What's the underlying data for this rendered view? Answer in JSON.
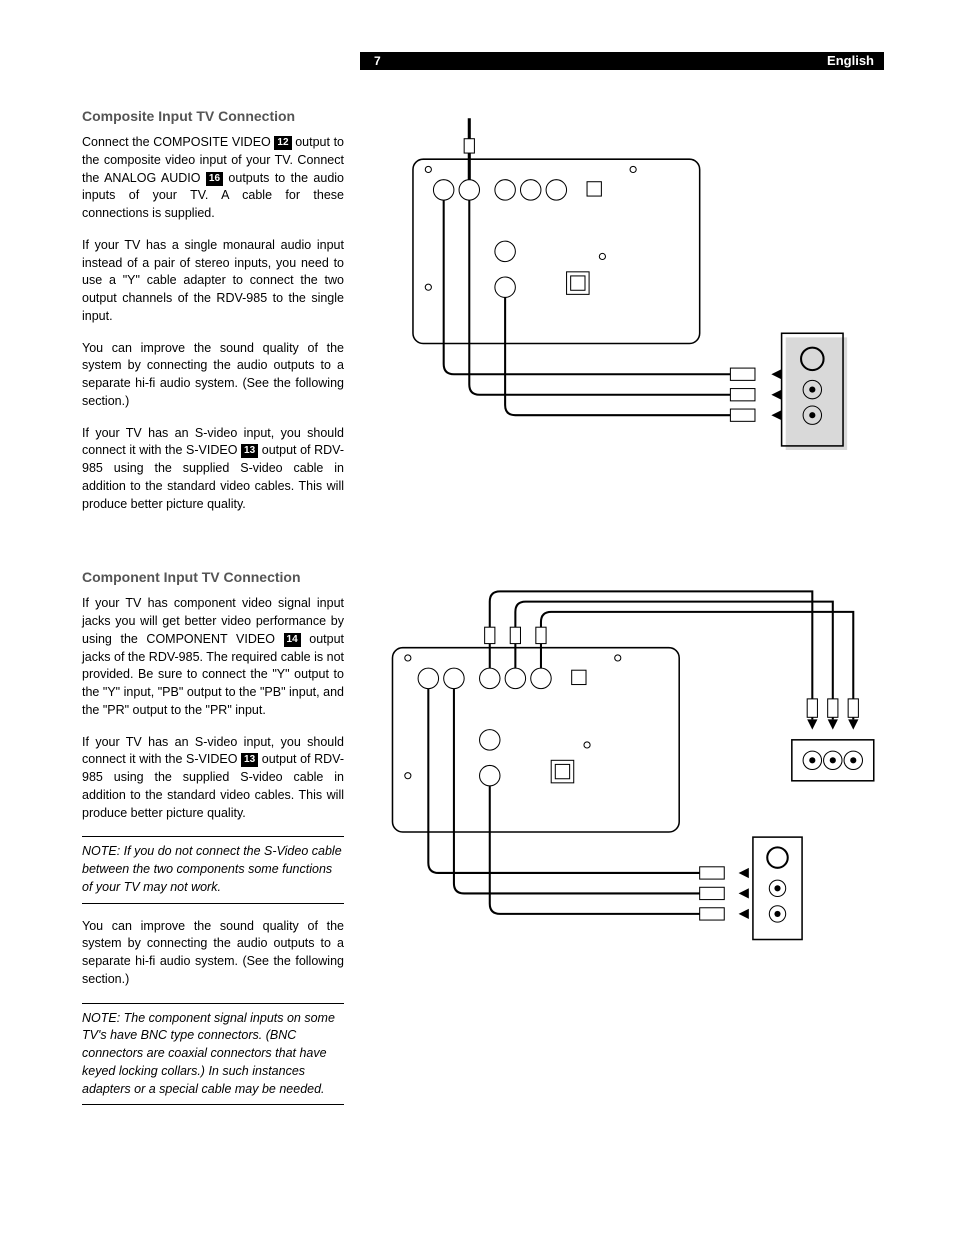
{
  "header": {
    "page_number": "7",
    "language": "English"
  },
  "refs": {
    "r12": "12",
    "r13": "13",
    "r14": "14",
    "r16": "16"
  },
  "section1": {
    "title": "Composite Input TV Connection",
    "p1a": "Connect the COMPOSITE VIDEO ",
    "p1b": " output to the composite video input of your TV. Connect the ANALOG AUDIO ",
    "p1c": " outputs to the audio inputs of your TV. A cable for these connections is supplied.",
    "p2": "If your TV has a single monaural audio input instead of a pair of stereo inputs, you need to use a \"Y\" cable adapter to connect the two output channels of the RDV-985 to the single input.",
    "p3": "You can improve the sound quality of the system by connecting the audio outputs to a separate hi-fi audio system. (See the following section.)",
    "p4a": "If your TV has an S-video input, you should connect it with the S-VIDEO ",
    "p4b": " output of RDV-985 using the supplied S-video cable in addition to the standard video cables. This will produce better picture quality."
  },
  "section2": {
    "title": "Component Input TV Connection",
    "p1a": "If your TV has component video signal input jacks you will get better video performance by using the COMPONENT VIDEO ",
    "p1b": " output jacks of the RDV-985. The required cable is not provided. Be sure to connect the \"Y\" output to the \"Y\" input, \"PB\" output to the \"PB\" input, and the \"PR\" output to the \"PR\" input.",
    "p2a": "If your TV has an S-video input, you should connect it with the S-VIDEO ",
    "p2b": " output of RDV-985 using the supplied S-video cable in addition to the standard video cables. This will produce better picture quality.",
    "note1": "NOTE: If you do not connect the S-Video cable between the two components some functions of your TV may not work.",
    "p3": "You can improve the sound quality of the system by connecting the audio outputs to a separate hi-fi audio system. (See the following section.)",
    "note2": "NOTE: The component signal inputs on some TV's have BNC type connectors. (BNC connectors are coaxial connectors that have keyed locking collars.) In such instances adapters or a special cable may be needed."
  }
}
